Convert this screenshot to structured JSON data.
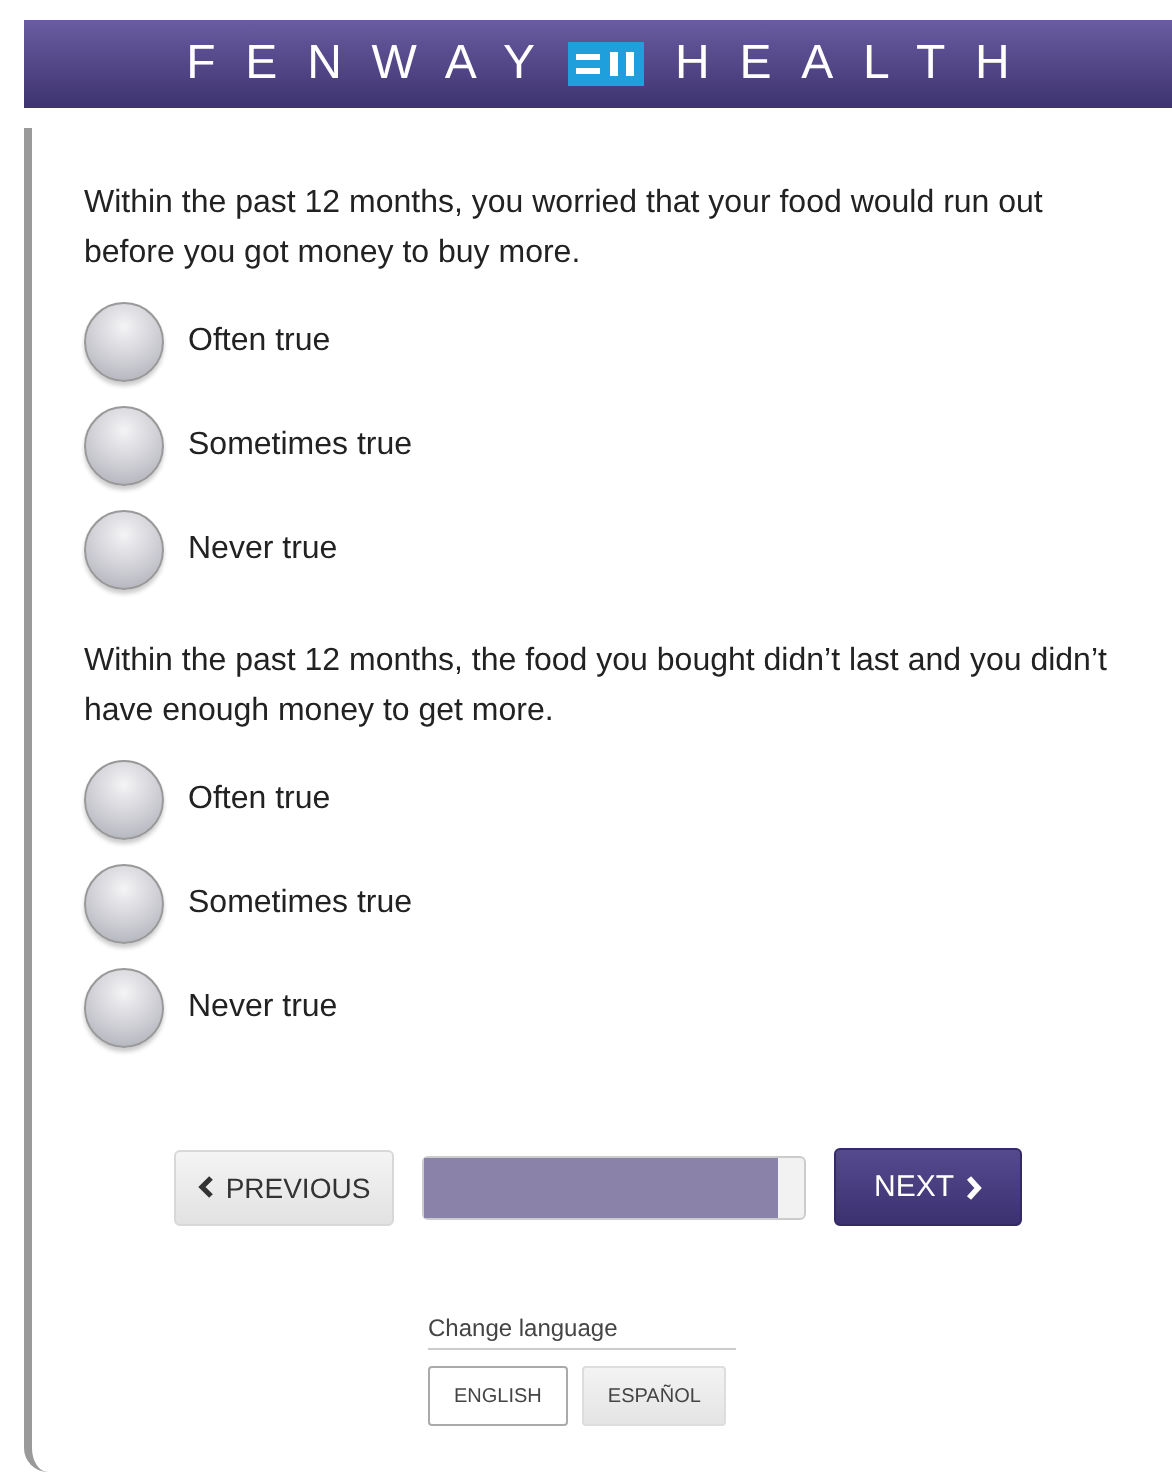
{
  "header": {
    "brand_left": "FENWAY",
    "brand_right": "HEALTH"
  },
  "questions": [
    {
      "text": "Within the past 12 months, you worried that your food would run out before you got money to buy more.",
      "options": [
        {
          "label": "Often true",
          "selected": false
        },
        {
          "label": "Sometimes true",
          "selected": false
        },
        {
          "label": "Never true",
          "selected": false
        }
      ]
    },
    {
      "text": "Within the past 12 months, the food you bought didn’t last and you didn’t have enough money to get more.",
      "options": [
        {
          "label": "Often true",
          "selected": false
        },
        {
          "label": "Sometimes true",
          "selected": false
        },
        {
          "label": "Never true",
          "selected": false
        }
      ]
    }
  ],
  "navigation": {
    "previous": "PREVIOUS",
    "next": "NEXT",
    "progress": {
      "level": 0.93
    }
  },
  "language": {
    "title": "Change language",
    "options": [
      {
        "label": "ENGLISH",
        "selected": true
      },
      {
        "label": "ESPAÑOL",
        "selected": false
      }
    ]
  }
}
